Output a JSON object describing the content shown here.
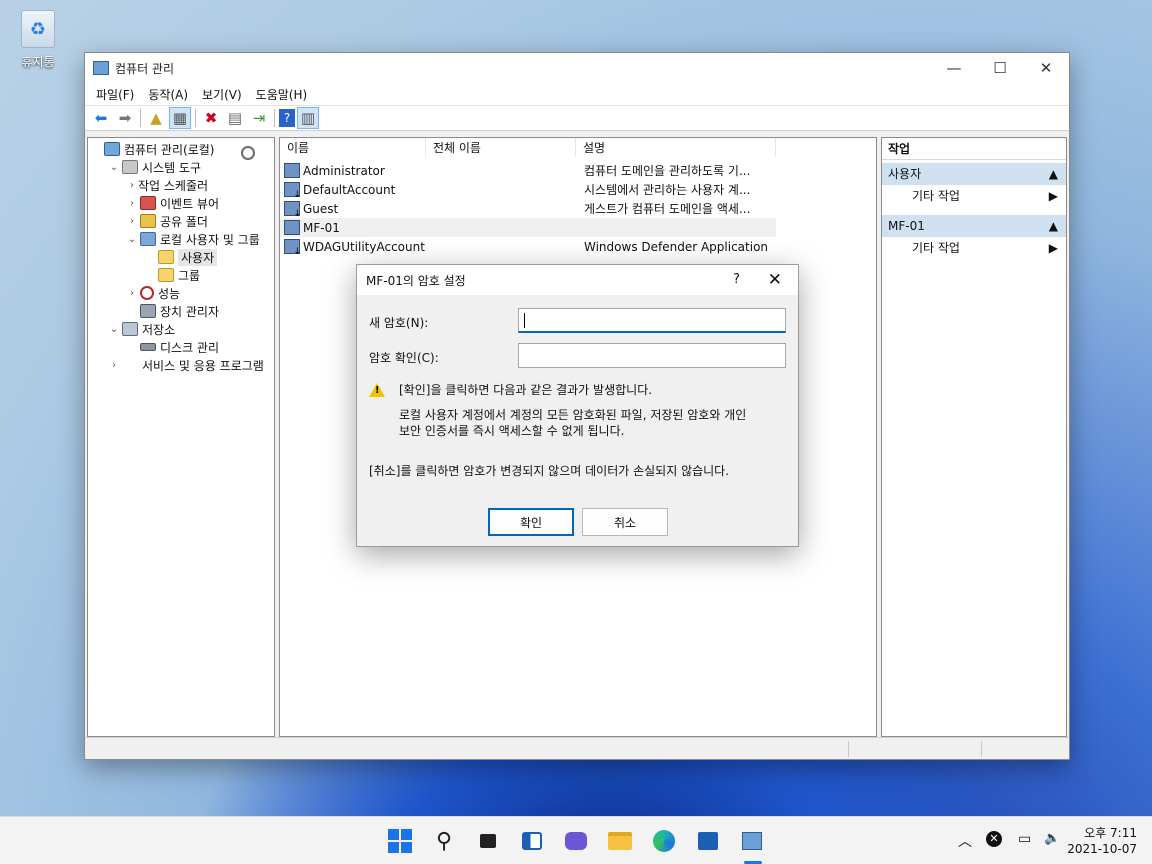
{
  "desktop": {
    "recycle_bin_label": "휴지통"
  },
  "window": {
    "title": "컴퓨터 관리",
    "menu": [
      "파일(F)",
      "동작(A)",
      "보기(V)",
      "도움말(H)"
    ],
    "tree": [
      {
        "label": "컴퓨터 관리(로컬)",
        "level": 0,
        "expander": "",
        "icon": "computer-management-icon"
      },
      {
        "label": "시스템 도구",
        "level": 1,
        "expander": "v",
        "icon": "tools-icon"
      },
      {
        "label": "작업 스케줄러",
        "level": 2,
        "expander": ">",
        "icon": "clock-icon"
      },
      {
        "label": "이벤트 뷰어",
        "level": 2,
        "expander": ">",
        "icon": "event-viewer-icon"
      },
      {
        "label": "공유 폴더",
        "level": 2,
        "expander": ">",
        "icon": "shared-folder-icon"
      },
      {
        "label": "로컬 사용자 및 그룹",
        "level": 2,
        "expander": "v",
        "icon": "users-groups-icon"
      },
      {
        "label": "사용자",
        "level": 3,
        "expander": "",
        "icon": "folder-icon",
        "selected": true
      },
      {
        "label": "그룹",
        "level": 3,
        "expander": "",
        "icon": "folder-icon"
      },
      {
        "label": "성능",
        "level": 2,
        "expander": ">",
        "icon": "performance-icon"
      },
      {
        "label": "장치 관리자",
        "level": 2,
        "expander": "",
        "icon": "device-manager-icon"
      },
      {
        "label": "저장소",
        "level": 1,
        "expander": "v",
        "icon": "storage-icon"
      },
      {
        "label": "디스크 관리",
        "level": 2,
        "expander": "",
        "icon": "disk-icon"
      },
      {
        "label": "서비스 및 응용 프로그램",
        "level": 1,
        "expander": ">",
        "icon": "services-icon"
      }
    ],
    "list": {
      "headers": [
        "이름",
        "전체 이름",
        "설명"
      ],
      "rows": [
        {
          "name": "Administrator",
          "full": "",
          "desc": "컴퓨터 도메인을 관리하도록 기...",
          "disabled": false
        },
        {
          "name": "DefaultAccount",
          "full": "",
          "desc": "시스템에서 관리하는 사용자 계...",
          "disabled": true
        },
        {
          "name": "Guest",
          "full": "",
          "desc": "게스트가 컴퓨터 도메인을 액세...",
          "disabled": true
        },
        {
          "name": "MF-01",
          "full": "",
          "desc": "",
          "disabled": false,
          "selected": true
        },
        {
          "name": "WDAGUtilityAccount",
          "full": "",
          "desc": "Windows Defender Application G...",
          "disabled": true
        }
      ]
    },
    "actions": {
      "title": "작업",
      "sections": [
        {
          "header": "사용자",
          "item": "기타 작업"
        },
        {
          "header": "MF-01",
          "item": "기타 작업"
        }
      ]
    }
  },
  "dialog": {
    "title": "MF-01의 암호 설정",
    "help": "?",
    "new_password_label": "새 암호(N):",
    "confirm_password_label": "암호 확인(C):",
    "new_password_value": "",
    "confirm_password_value": "",
    "warning_line": "[확인]을 클릭하면 다음과 같은 결과가 발생합니다.",
    "warning_detail_1": "로컬 사용자 계정에서 계정의 모든 암호화된 파일, 저장된 암호와 개인",
    "warning_detail_2": "보안 인증서를 즉시 액세스할 수 없게 됩니다.",
    "cancel_note": "[취소]를 클릭하면 암호가 변경되지 않으며 데이터가 손실되지 않습니다.",
    "ok_label": "확인",
    "cancel_label": "취소"
  },
  "taskbar": {
    "time": "오후 7:11",
    "date": "2021-10-07"
  },
  "colors": {
    "accent": "#0067c0",
    "selection": "#cfe0f1",
    "warning": "#f2c400"
  }
}
